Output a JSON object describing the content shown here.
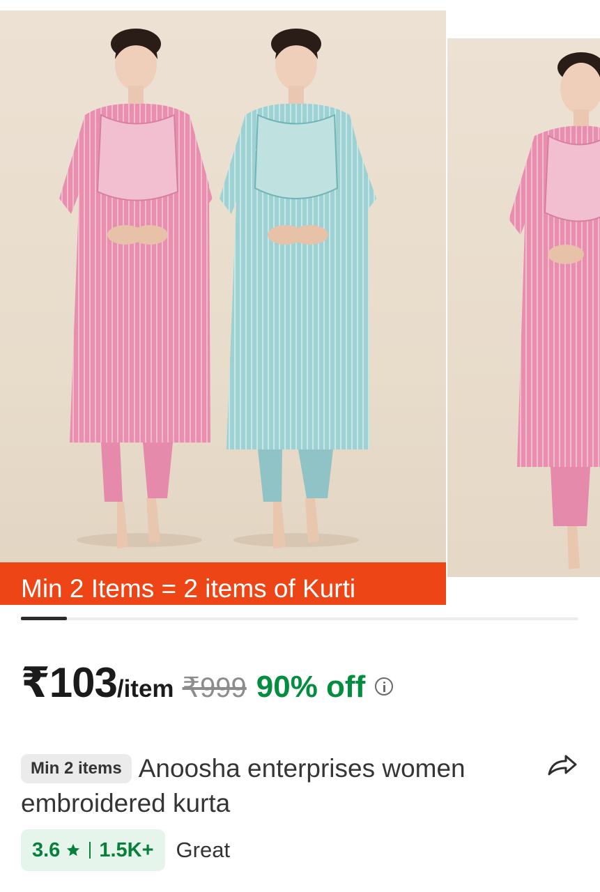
{
  "carousel": {
    "banner_text": "Min 2 Items = 2 items of Kurti",
    "image_main": "product-photo-pink-and-blue-kurtas",
    "image_next": "product-photo-pink-kurta",
    "active_slide": 1
  },
  "price": {
    "current": "₹103",
    "unit": "/item",
    "mrp": "₹999",
    "discount": "90% off",
    "info_icon": "info-icon"
  },
  "product": {
    "min_badge": "Min 2 items",
    "title": "Anoosha enterprises women embroidered kurta",
    "share_icon": "share-icon"
  },
  "rating": {
    "score": "3.6",
    "star_icon": "star-icon",
    "count": "1.5K+",
    "label": "Great"
  },
  "colors": {
    "banner": "#ee4517",
    "discount": "#038d3f",
    "rating": "#06803b",
    "rating_bg": "#e5f5ec"
  }
}
